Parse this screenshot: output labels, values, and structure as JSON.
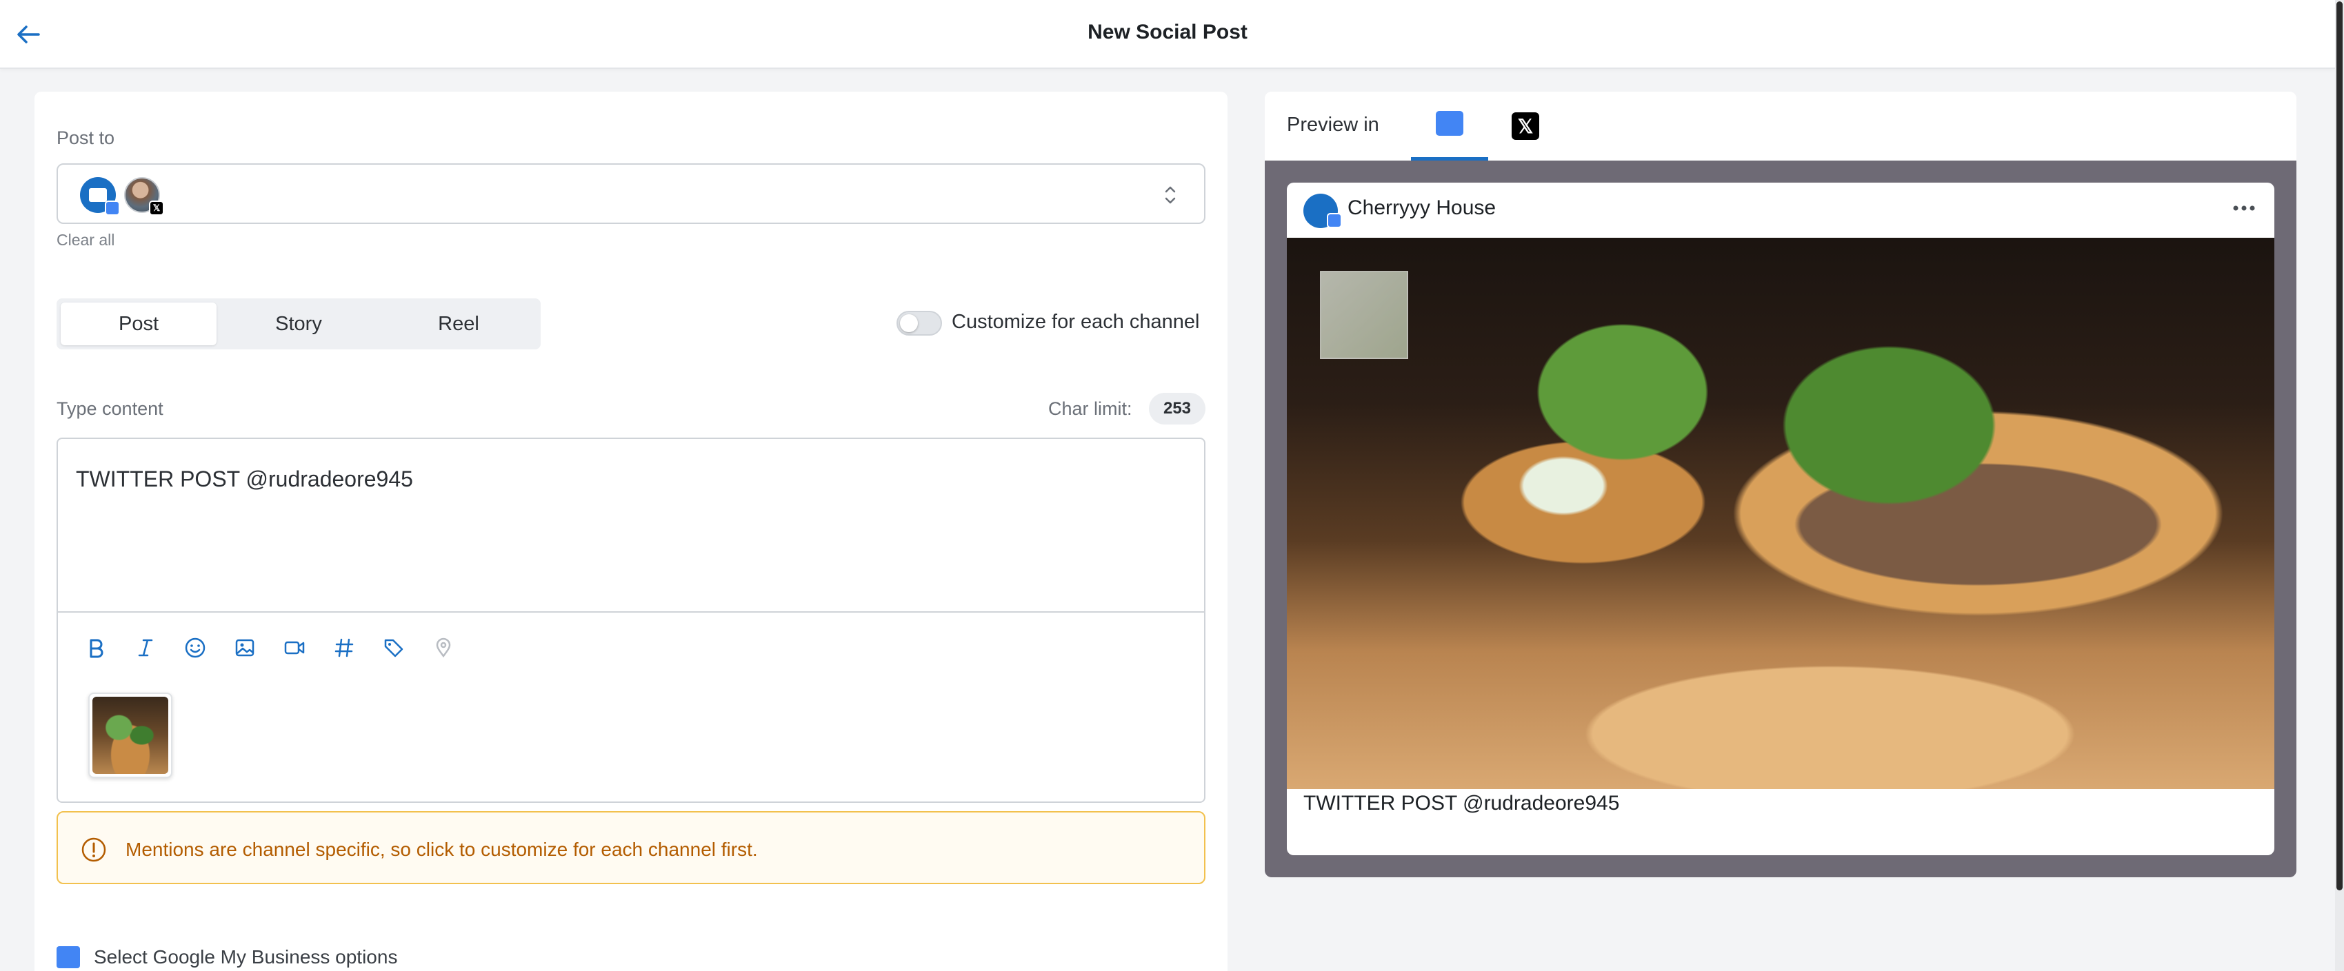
{
  "header": {
    "title": "New Social Post"
  },
  "composer": {
    "post_to_label": "Post to",
    "clear_all_label": "Clear all",
    "post_types": [
      "Post",
      "Story",
      "Reel"
    ],
    "selected_post_type": "Post",
    "customize_label": "Customize for each channel",
    "customize_enabled": false,
    "type_content_label": "Type content",
    "char_limit_label": "Char limit:",
    "char_limit_value": "253",
    "content_text": "TWITTER POST @rudradeore945",
    "toolbar_icons": [
      "bold-icon",
      "italic-icon",
      "emoji-icon",
      "image-icon",
      "video-icon",
      "hashtag-icon",
      "tag-icon",
      "location-icon"
    ],
    "alert_text": "Mentions are channel specific, so click to customize for each channel first.",
    "gmb_options_label": "Select Google My Business options"
  },
  "preview": {
    "label": "Preview in",
    "tabs": [
      "google-my-business-icon",
      "x-icon"
    ],
    "active_tab": "google-my-business-icon",
    "card": {
      "account_name": "Cherryyy House",
      "caption": "TWITTER POST @rudradeore945"
    }
  },
  "colors": {
    "accent": "#1a6fc4",
    "alert_border": "#f2c14e",
    "alert_text": "#b35c00",
    "preview_bg": "#6e6a75"
  }
}
